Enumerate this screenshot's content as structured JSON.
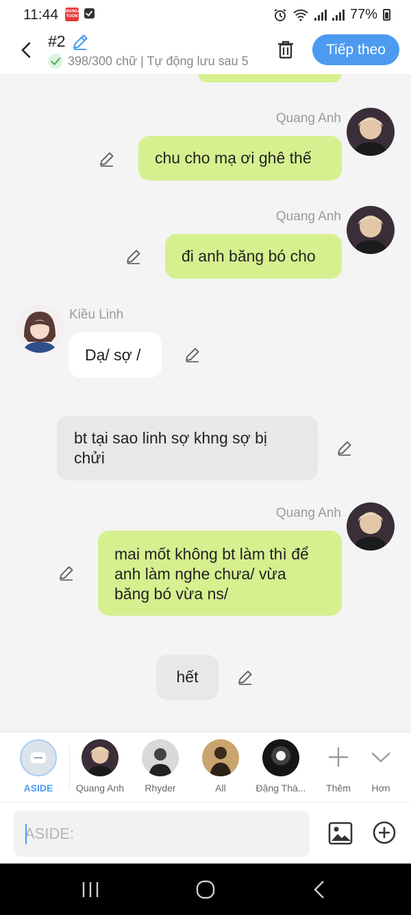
{
  "status": {
    "time": "11:44",
    "battery": "77%",
    "app_badge": "MANGA TOON"
  },
  "header": {
    "episode": "#2",
    "saved_info": "398/300 chữ | Tự động lưu sau 5",
    "next_label": "Tiếp theo"
  },
  "messages": [
    {
      "type": "right",
      "name": "Quang Anh",
      "text": "chu cho mạ ơi ghê thế"
    },
    {
      "type": "right",
      "name": "Quang Anh",
      "text": "đi anh băng bó cho"
    },
    {
      "type": "left",
      "name": "Kiều Linh",
      "text": "Dạ/ sợ /"
    },
    {
      "type": "aside",
      "text": "bt tại sao linh sợ khng sợ bị chửi"
    },
    {
      "type": "right",
      "name": "Quang Anh",
      "text": "mai mốt không bt làm thì để anh làm nghe chưa/ vừa băng bó vừa ns/"
    },
    {
      "type": "aside",
      "text": "hết"
    }
  ],
  "characters": [
    {
      "label": "ASIDE",
      "active": true
    },
    {
      "label": "Quang Anh"
    },
    {
      "label": "Rhyder"
    },
    {
      "label": "All"
    },
    {
      "label": "Đặng Thà..."
    }
  ],
  "actions": {
    "more_label": "Thêm",
    "collapse_label": "Hơn"
  },
  "input": {
    "placeholder": "ASIDE:"
  },
  "colors": {
    "accent": "#4c9bf0",
    "green_bubble": "#d6f090",
    "aside_bubble": "#e8e8e8"
  }
}
